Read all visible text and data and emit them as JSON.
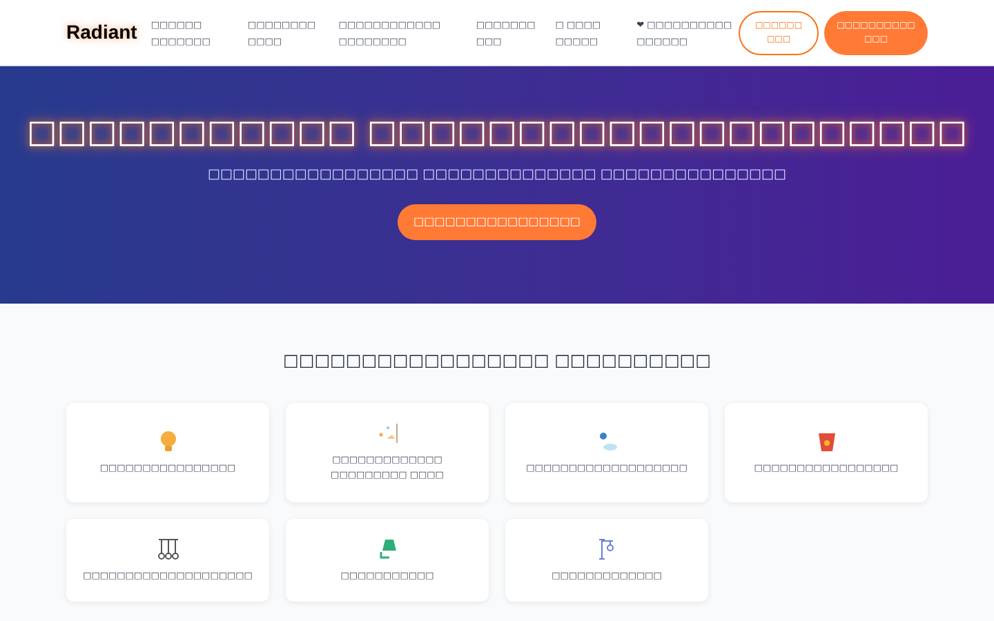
{
  "brand": "Radiant",
  "nav": [
    {
      "label": "□□□□□□ □□□□□□□"
    },
    {
      "label": "□□□□□□□□ □□□□"
    },
    {
      "label": "□□□□□□□□□□□□ □□□□□□□□"
    },
    {
      "label": "□□□□□□□ □□□"
    },
    {
      "label": "□ □□□□ □□□□□"
    },
    {
      "label": "❤ □□□□□□□□□□ □□□□□□"
    }
  ],
  "buttons": [
    {
      "label": "□□□□□□ □□□",
      "kind": "outline"
    },
    {
      "label": "□□□□□□□□□□ □□□",
      "kind": "filled"
    }
  ],
  "hero": {
    "title": "□□□□□□□□□□□ □□□□□□□□□□□□□□□□□□□□",
    "subtitle": "□□□□□□□□□□□□□□□□□ □□□□□□□□□□□□□□ □□□□□□□□□□□□□□□",
    "cta": "□□□□□□□□□□□□□□□□"
  },
  "section": {
    "heading": "□□□□□□□□□□□□□□□□□ □□□□□□□□□□",
    "cards": [
      {
        "label": "□□□□□□□□□□□□□□□□"
      },
      {
        "label": "□□□□□□□□□□□□□ □□□□□□□□□ □□□□"
      },
      {
        "label": "□□□□□□□□□□□□□□□□□□□"
      },
      {
        "label": "□□□□□□□□□□□□□□□□□"
      },
      {
        "label": "□□□□□□□□□□□□□□□□□□□□"
      },
      {
        "label": "□□□□□□□□□□□"
      },
      {
        "label": "□□□□□□□□□□□□□"
      }
    ]
  }
}
